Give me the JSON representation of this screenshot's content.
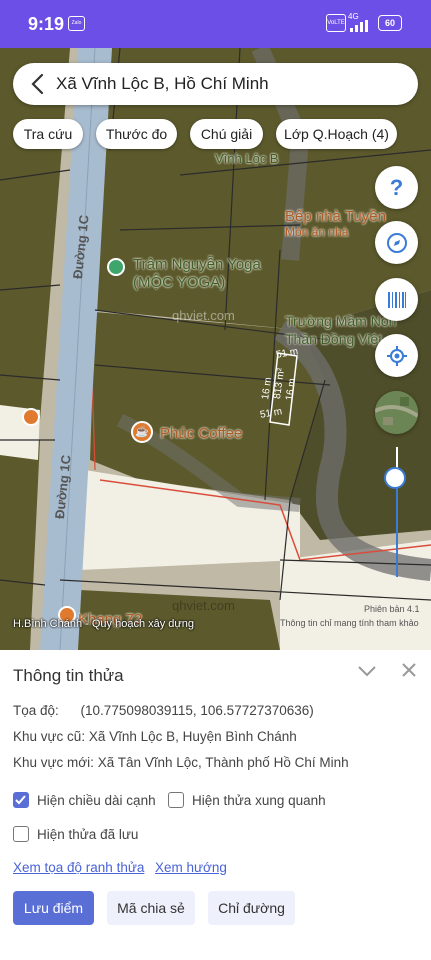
{
  "status": {
    "time": "9:19",
    "battery": "60",
    "zalo": "Zalo",
    "network": "4G",
    "lte": "VoLTE"
  },
  "search": {
    "title": "Xã Vĩnh Lộc B, Hồ Chí Minh"
  },
  "chips": [
    "Tra cứu",
    "Thước đo",
    "Chú giải",
    "Lớp Q.Hoạch (4)"
  ],
  "map": {
    "pois": {
      "yoga_1": "Trâm Nguyễn Yoga",
      "yoga_2": "(MỘC YOGA)",
      "coffee": "Phúc Coffee",
      "bep_1": "Bếp nhà Tuyền",
      "bep_2": "Món ăn nhà",
      "school_1": "Trường Mầm Non",
      "school_2": "Thần Đồng Việt",
      "vinhlocb": "Vĩnh Lộc B",
      "khang": "Khang 72"
    },
    "roads": [
      "Đường 1C",
      "Đường 1C"
    ],
    "watermark": "qhviet.com",
    "dims": {
      "top": "51 m",
      "bottom": "51 m",
      "left": "16 m",
      "right": "16 m",
      "area": "813 m²"
    },
    "source": "H.Bình Chánh - Quy hoạch xây dựng",
    "version": "Phiên bản 4.1",
    "disclaimer": "Thông tin chỉ mang tính tham khảo",
    "slider_level": 0.25
  },
  "panel": {
    "title": "Thông tin thửa",
    "coord_label": "Tọa độ:",
    "coord_value": "(10.775098039115, 106.57727370636)",
    "old_area_label": "Khu vực cũ:",
    "old_area_value": "Xã Vĩnh Lộc B, Huyện Bình Chánh",
    "new_area_label": "Khu vực mới:",
    "new_area_value": "Xã Tân Vĩnh Lộc, Thành phố Hồ Chí Minh",
    "cb_length": "Hiện chiều dài cạnh",
    "cb_length_checked": true,
    "cb_around": "Hiện thửa xung quanh",
    "cb_around_checked": false,
    "cb_saved": "Hiện thửa đã lưu",
    "cb_saved_checked": false,
    "link_coords": "Xem tọa độ ranh thửa",
    "link_direction": "Xem hướng",
    "btn_save": "Lưu điểm",
    "btn_share": "Mã chia sẻ",
    "btn_directions": "Chỉ đường"
  },
  "colors": {
    "accent": "#5a6fd6",
    "status_bar": "#6b4fe6",
    "parcel": "#5c5a2c"
  }
}
